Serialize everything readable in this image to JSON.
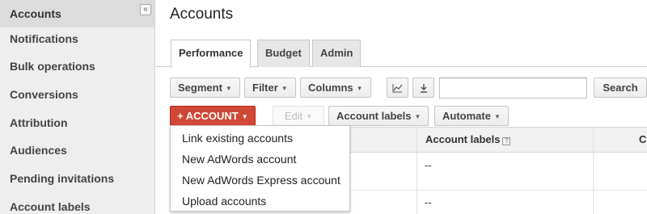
{
  "sidebar": {
    "collapse_glyph": "«",
    "items": [
      {
        "label": "Accounts",
        "active": true
      },
      {
        "label": "Notifications"
      },
      {
        "label": "Bulk operations"
      },
      {
        "label": "Conversions"
      },
      {
        "label": "Attribution"
      },
      {
        "label": "Audiences"
      },
      {
        "label": "Pending invitations"
      },
      {
        "label": "Account labels"
      }
    ]
  },
  "header": {
    "title": "Accounts"
  },
  "tabs": [
    {
      "label": "Performance",
      "active": true
    },
    {
      "label": "Budget"
    },
    {
      "label": "Admin"
    }
  ],
  "toolbar": {
    "segment": "Segment",
    "filter": "Filter",
    "columns": "Columns",
    "chart_icon": "line-chart-icon",
    "download_icon": "download-icon",
    "search_value": "",
    "search_button": "Search"
  },
  "actions": {
    "account_button": "ACCOUNT",
    "account_plus": "+",
    "edit": "Edit",
    "account_labels": "Account labels",
    "automate": "Automate"
  },
  "menu": {
    "items": [
      "Link existing accounts",
      "New AdWords account",
      "New AdWords Express account",
      "Upload accounts"
    ]
  },
  "table": {
    "columns": [
      "Account labels",
      "C"
    ],
    "help_glyph": "?",
    "rows": [
      {
        "account_labels": "--"
      },
      {
        "account_labels": "--"
      }
    ]
  },
  "colors": {
    "accent_red": "#d14836",
    "sidebar_bg": "#eeeeee",
    "active_item_bg": "#dcdcdc"
  }
}
